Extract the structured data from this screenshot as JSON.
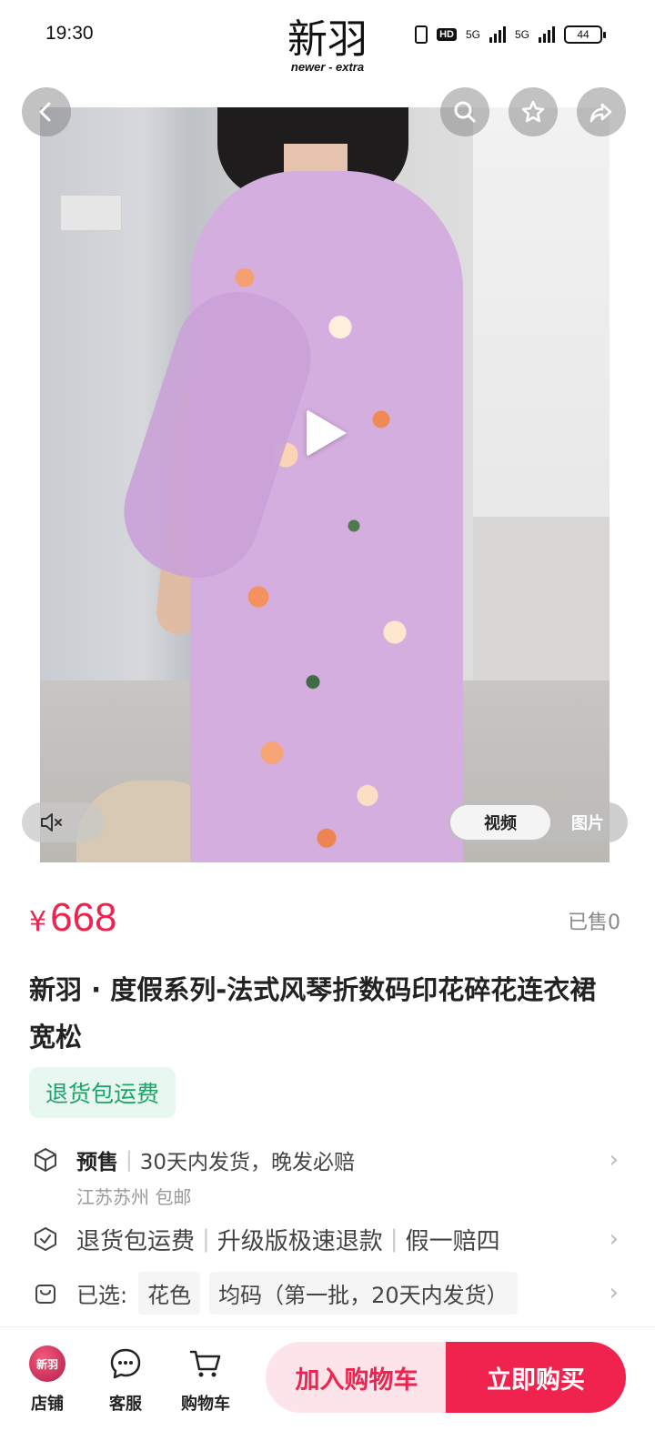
{
  "status_bar": {
    "time": "19:30",
    "hd_label": "HD",
    "network_1": "5G",
    "network_2": "5G",
    "battery": "44"
  },
  "header": {
    "brand_cn": "新羽",
    "brand_en": "newer - extra",
    "icons": [
      "back-icon",
      "search-icon",
      "star-icon",
      "share-icon"
    ]
  },
  "media": {
    "tabs": [
      {
        "label": "视频",
        "active": true
      },
      {
        "label": "图片",
        "active": false
      }
    ],
    "mute_icon": "speaker-muted-icon",
    "play_icon": "play-icon"
  },
  "product": {
    "currency": "¥",
    "price": "668",
    "sold": "已售0",
    "title": "新羽 · 度假系列-法式风琴折数码印花碎花连衣裙 宽松",
    "tag": "退货包运费"
  },
  "rows": {
    "presale": {
      "label": "预售",
      "text": "30天内发货，晚发必赔",
      "sub": "江苏苏州 包邮"
    },
    "service": {
      "items": [
        "退货包运费",
        "升级版极速退款",
        "假一赔四"
      ]
    },
    "selected": {
      "label": "已选:",
      "chips": [
        "花色",
        "均码（第一批，20天内发货）"
      ]
    }
  },
  "bottom_bar": {
    "shop_label": "店铺",
    "shop_logo_text": "新羽",
    "service_label": "客服",
    "cart_label": "购物车",
    "add_cart_button": "加入购物车",
    "buy_now_button": "立即购买"
  },
  "colors": {
    "price_red": "#ee2450",
    "tag_green": "#1aa56a",
    "buy_red": "#f0234f"
  }
}
